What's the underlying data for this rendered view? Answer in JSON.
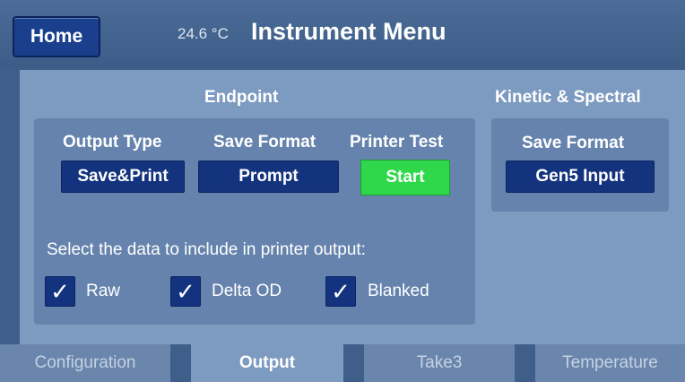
{
  "header": {
    "home_label": "Home",
    "temperature": "24.6 °C",
    "title": "Instrument Menu"
  },
  "endpoint": {
    "title": "Endpoint",
    "output_type_label": "Output Type",
    "output_type_value": "Save&Print",
    "save_format_label": "Save Format",
    "save_format_value": "Prompt",
    "printer_test_label": "Printer Test",
    "printer_test_button": "Start",
    "select_data_label": "Select the data to include in printer output:",
    "checkboxes": [
      {
        "label": "Raw",
        "checked": true
      },
      {
        "label": "Delta OD",
        "checked": true
      },
      {
        "label": "Blanked",
        "checked": true
      }
    ]
  },
  "kinetic": {
    "title": "Kinetic & Spectral",
    "save_format_label": "Save Format",
    "save_format_value": "Gen5 Input"
  },
  "tabs": [
    {
      "label": "Configuration",
      "active": false
    },
    {
      "label": "Output",
      "active": true
    },
    {
      "label": "Take3",
      "active": false
    },
    {
      "label": "Temperature",
      "active": false
    }
  ],
  "check_glyph": "✓",
  "colors": {
    "button_blue": "#14337e",
    "start_green": "#2fd84a",
    "panel": "#7d9ac0"
  }
}
